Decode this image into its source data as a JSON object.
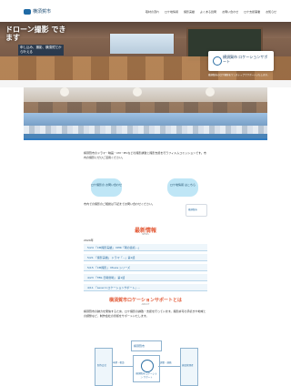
{
  "header": {
    "logo_text": "横須賀市",
    "nav": [
      "取材の流れ",
      "ロケ地情報",
      "撮影実績",
      "よくある質問",
      "お問い合わせ",
      "ロケ支援事業",
      "お知らせ"
    ]
  },
  "hero": {
    "title": "ドローン撮影 できます",
    "subtitle": "申し込み、撮影、横須賀だから叶える",
    "card_text": "横須賀市 ロケーションサポート",
    "caption": "横須賀市のロケ撮影をワンストップでサポートいたします。"
  },
  "intro": {
    "text": "横須賀市のドラマ・映画・CM・MVなどの撮影誘致と撮影支援を行うフィルムコミッションです。市内の撮影にぜひご活用ください。",
    "pill1": "ロケ撮影の お問い合わせ",
    "pill2": "ロケ地情報 はこちら",
    "text2": "市内での撮影のご相談は下記までお問い合わせください。",
    "mini_logo_text": "横須賀市"
  },
  "news": {
    "title": "最新情報",
    "subtitle": "NEWS",
    "year": "2024年",
    "items": [
      "5/24 「CM撮影実績」 NHK「朝の連続...」",
      "5/21 「撮影実績」 ドラマ「...」第1話",
      "5/15 「CM撮影」 Movie シリーズ",
      "4/23 「TBS 日曜劇場」 第1話",
      "4/11 「Level 1 ロケーションサポート」..."
    ]
  },
  "about": {
    "title": "横須賀市ロケーションサポートとは",
    "subtitle": "ABOUT",
    "text": "横須賀市の魅力を発信するため、ロケ撮影の誘致・支援を行っています。撮影許可の手続きや地域との調整など、制作会社の皆様をサポートいたします。"
  },
  "diagram": {
    "top": "横須賀市",
    "center": "横須賀市 ロケーション サポート",
    "left": "制作会社",
    "right": "施設管理者",
    "label_left": "申請・相談",
    "label_right": "調整・連絡"
  }
}
